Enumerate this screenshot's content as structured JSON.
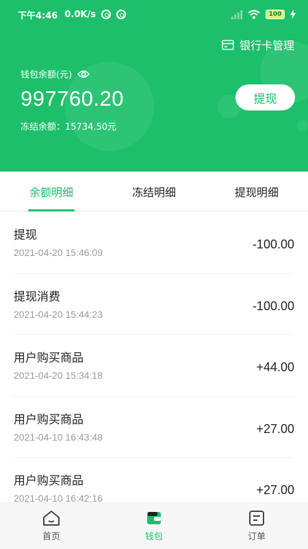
{
  "status_bar": {
    "time": "下午4:46",
    "speed": "0.0K/s",
    "battery": "100"
  },
  "header": {
    "bank_card_label": "银行卡管理",
    "balance_label": "钱包余额(元)",
    "balance_value": "997760.20",
    "frozen_label": "冻结余额：",
    "frozen_value": "15734.50元",
    "withdraw_label": "提现"
  },
  "tabs": [
    {
      "label": "余额明细",
      "active": true
    },
    {
      "label": "冻结明细",
      "active": false
    },
    {
      "label": "提现明细",
      "active": false
    }
  ],
  "transactions": [
    {
      "title": "提现",
      "date": "2021-04-20 15:46:09",
      "amount": "-100.00"
    },
    {
      "title": "提现消费",
      "date": "2021-04-20 15:44:23",
      "amount": "-100.00"
    },
    {
      "title": "用户购买商品",
      "date": "2021-04-20 15:34:18",
      "amount": "+44.00"
    },
    {
      "title": "用户购买商品",
      "date": "2021-04-10 16:43:48",
      "amount": "+27.00"
    },
    {
      "title": "用户购买商品",
      "date": "2021-04-10 16:42:16",
      "amount": "+27.00"
    }
  ],
  "bottom_nav": [
    {
      "label": "首页",
      "icon": "home-icon",
      "active": false
    },
    {
      "label": "钱包",
      "icon": "wallet-icon",
      "active": true
    },
    {
      "label": "订单",
      "icon": "order-icon",
      "active": false
    }
  ],
  "colors": {
    "brand_green": "#1dbf6b",
    "date_gray": "#9a9a9a"
  }
}
